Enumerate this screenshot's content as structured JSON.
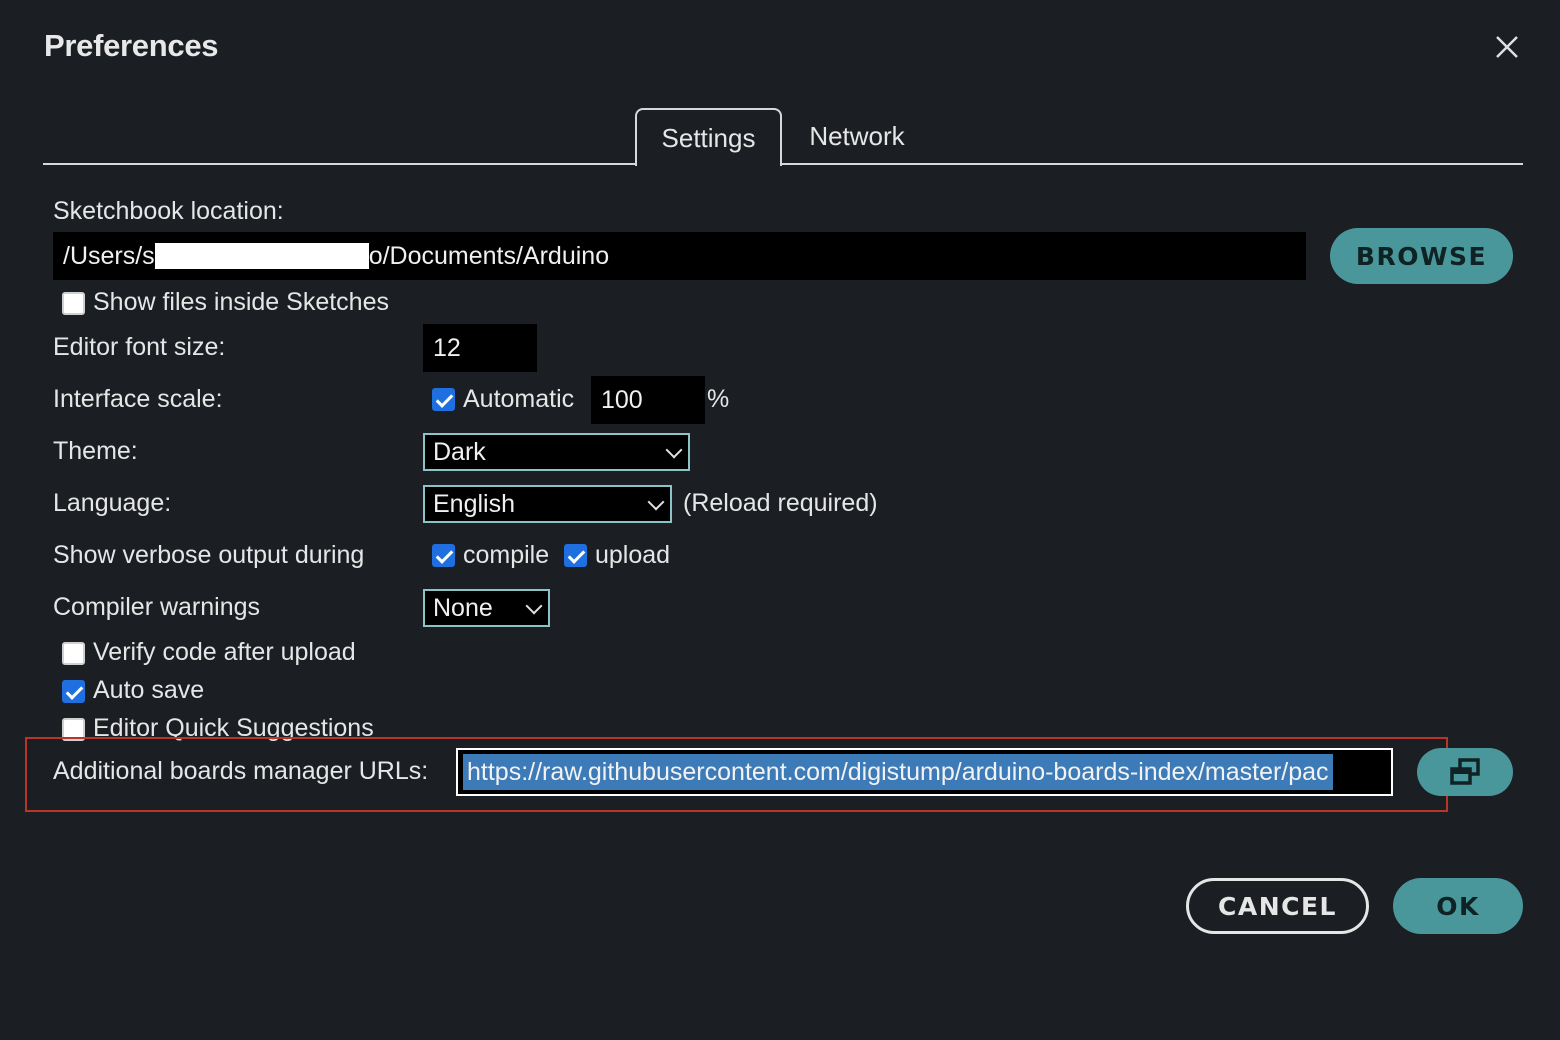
{
  "dialog": {
    "title": "Preferences",
    "close_icon": "close-icon"
  },
  "tabs": [
    {
      "label": "Settings",
      "active": true
    },
    {
      "label": "Network",
      "active": false
    }
  ],
  "sketchbook": {
    "label": "Sketchbook location:",
    "path_prefix": "/Users/s",
    "path_suffix": "o/Documents/Arduino",
    "browse_label": "BROWSE"
  },
  "show_files": {
    "label": "Show files inside Sketches",
    "checked": false
  },
  "font_size": {
    "label": "Editor font size:",
    "value": "12"
  },
  "interface_scale": {
    "label": "Interface scale:",
    "automatic_label": "Automatic",
    "automatic_checked": true,
    "value": "100",
    "unit": "%"
  },
  "theme": {
    "label": "Theme:",
    "value": "Dark"
  },
  "language": {
    "label": "Language:",
    "value": "English",
    "note": "(Reload required)"
  },
  "verbose": {
    "label": "Show verbose output during",
    "compile_label": "compile",
    "compile_checked": true,
    "upload_label": "upload",
    "upload_checked": true
  },
  "compiler_warnings": {
    "label": "Compiler warnings",
    "value": "None"
  },
  "verify": {
    "label": "Verify code after upload",
    "checked": false
  },
  "auto_save": {
    "label": "Auto save",
    "checked": true
  },
  "quick_suggestions": {
    "label": "Editor Quick Suggestions",
    "checked": false
  },
  "boards_urls": {
    "label": "Additional boards manager URLs:",
    "value": "https://raw.githubusercontent.com/digistump/arduino-boards-index/master/pac",
    "edit_icon": "open-window-icon"
  },
  "footer": {
    "cancel_label": "CANCEL",
    "ok_label": "OK"
  },
  "colors": {
    "accent": "#4a979b",
    "background": "#1b1f24",
    "checkbox": "#1f6fe0",
    "highlight": "#b8352a"
  }
}
